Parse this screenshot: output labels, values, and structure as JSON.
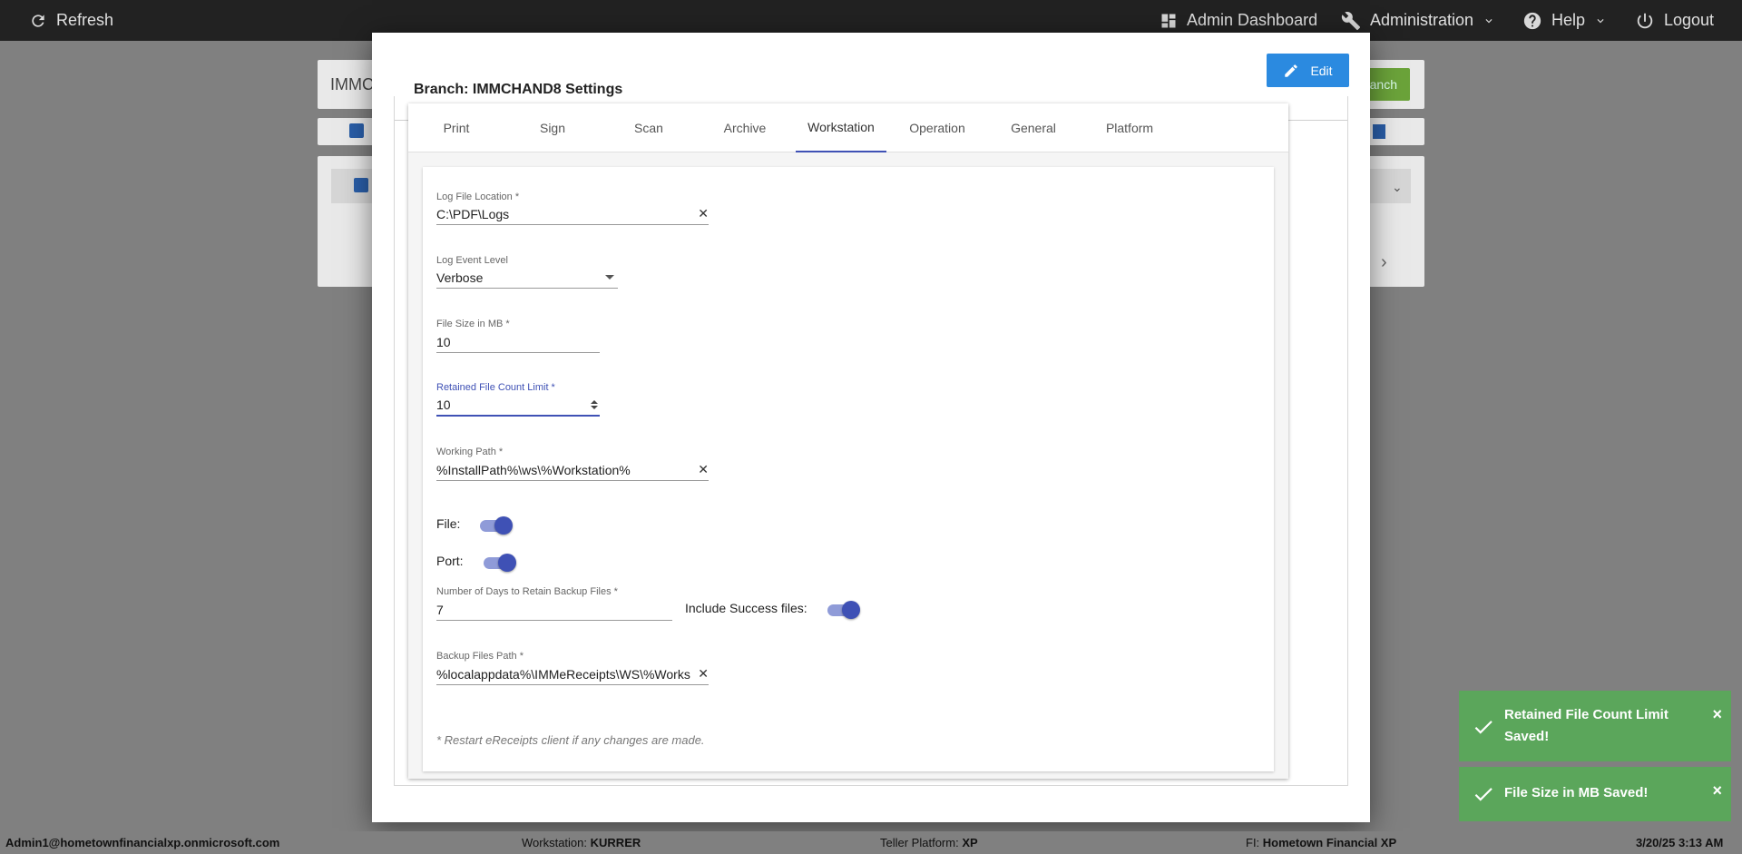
{
  "topbar": {
    "refresh_label": "Refresh",
    "admin_dashboard_label": "Admin Dashboard",
    "administration_label": "Administration",
    "help_label": "Help",
    "logout_label": "Logout"
  },
  "background": {
    "search_partial": "IMMC",
    "add_branch_partial": "anch"
  },
  "modal": {
    "title": "Branch: IMMCHAND8 Settings",
    "edit_label": "Edit",
    "tabs": [
      {
        "label": "Print"
      },
      {
        "label": "Sign"
      },
      {
        "label": "Scan"
      },
      {
        "label": "Archive"
      },
      {
        "label": "Workstation",
        "active": true
      },
      {
        "label": "Operation"
      },
      {
        "label": "General"
      },
      {
        "label": "Platform"
      }
    ],
    "form": {
      "log_file_location": {
        "label": "Log File Location *",
        "value": "C:\\PDF\\Logs"
      },
      "log_event_level": {
        "label": "Log Event Level",
        "value": "Verbose"
      },
      "file_size_mb": {
        "label": "File Size in MB *",
        "value": "10"
      },
      "retained_file_count": {
        "label": "Retained File Count Limit *",
        "value": "10"
      },
      "working_path": {
        "label": "Working Path *",
        "value": "%InstallPath%\\ws\\%Workstation%"
      },
      "file_toggle": {
        "label": "File:",
        "on": true
      },
      "port_toggle": {
        "label": "Port:",
        "on": true
      },
      "backup_days": {
        "label": "Number of Days to Retain Backup Files *",
        "value": "7"
      },
      "include_success": {
        "label": "Include Success files:",
        "on": true
      },
      "backup_path": {
        "label": "Backup Files Path *",
        "value": "%localappdata%\\IMMeReceipts\\WS\\%Works"
      },
      "note": "* Restart eReceipts client if any changes are made."
    }
  },
  "toasts": [
    {
      "line1": "Retained File Count Limit",
      "line2": "Saved!"
    },
    {
      "line1": "File Size in MB Saved!"
    }
  ],
  "statusbar": {
    "user": "Admin1@hometownfinancialxp.onmicrosoft.com",
    "workstation_label": "Workstation:",
    "workstation_value": "KURRER",
    "platform_label": "Teller Platform:",
    "platform_value": "XP",
    "fi_label": "FI:",
    "fi_value": "Hometown Financial XP",
    "datetime": "3/20/25 3:13 AM"
  },
  "colors": {
    "accent": "#3f51b5",
    "edit_button": "#2b8ae0",
    "toast_success": "#5ba65b",
    "topbar": "#222222"
  }
}
